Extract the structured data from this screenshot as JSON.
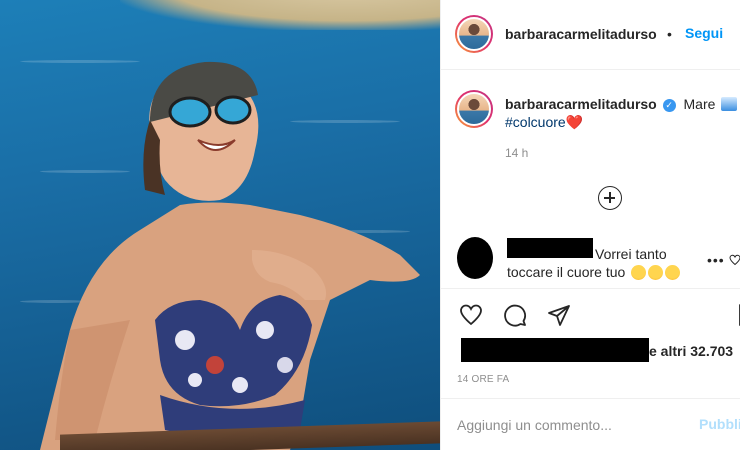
{
  "post": {
    "username": "barbaracarmelitadurso",
    "follow_label": "Segui",
    "header_dot": "•",
    "caption": "Mare",
    "hashtag": "#colcuore",
    "heart": "❤️",
    "timestamp": "14 h"
  },
  "comment": {
    "text_line1": "Vorrei tanto",
    "text_line2": "toccare il cuore tuo",
    "options": "•••"
  },
  "likes": {
    "text": "e altri 32.703"
  },
  "post_time": "14 ORE FA",
  "add_comment": {
    "placeholder": "Aggiungi un commento...",
    "publish_label": "Pubblica"
  },
  "icons": {
    "like": "heart-icon",
    "comment": "comment-icon",
    "share": "share-icon",
    "save": "bookmark-icon",
    "more": "plus-circle-icon",
    "verified": "verified-badge-icon"
  },
  "colors": {
    "link": "#0095f6",
    "hashtag": "#00376b",
    "publish_disabled": "#b2dffc",
    "verified": "#3897f0"
  }
}
